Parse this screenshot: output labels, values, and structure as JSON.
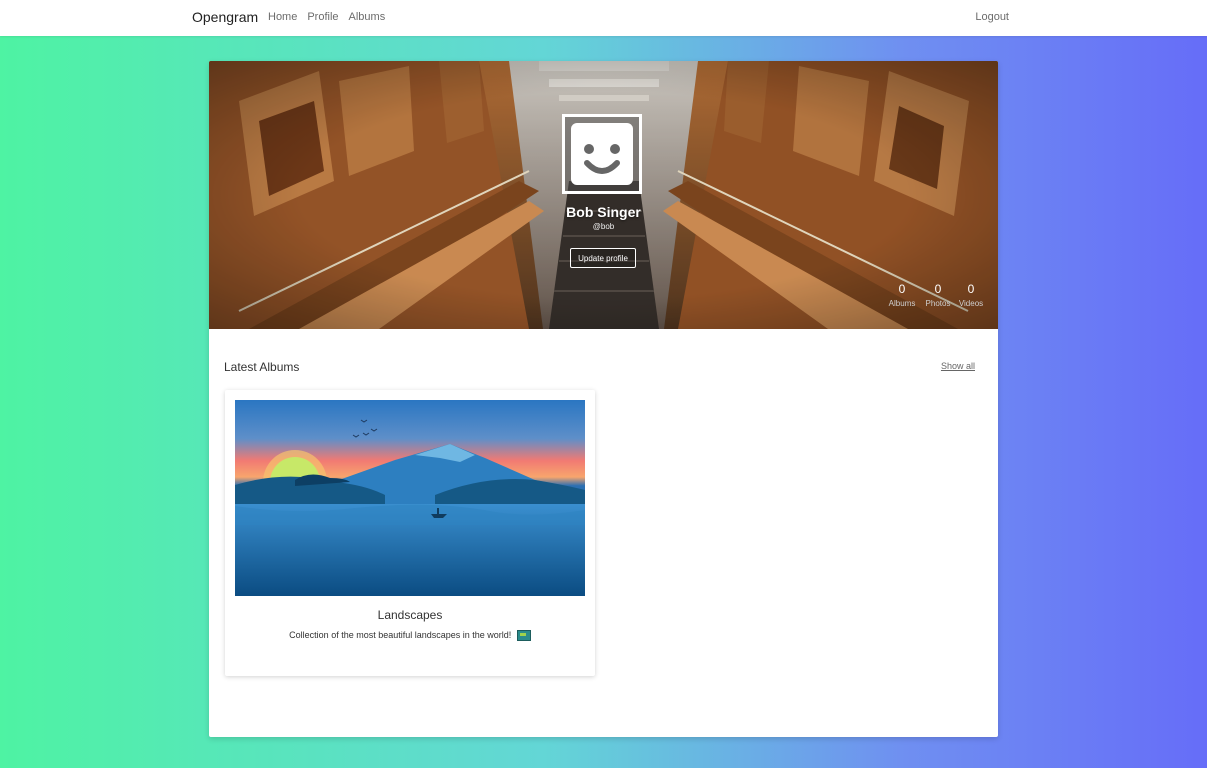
{
  "navbar": {
    "brand": "Opengram",
    "links": [
      "Home",
      "Profile",
      "Albums"
    ],
    "logout": "Logout"
  },
  "profile": {
    "name": "Bob Singer",
    "handle": "@bob",
    "update_button": "Update profile",
    "stats": [
      {
        "value": "0",
        "label": "Albums"
      },
      {
        "value": "0",
        "label": "Photos"
      },
      {
        "value": "0",
        "label": "Videos"
      }
    ],
    "avatar_icon": "smiley-face-icon"
  },
  "latest": {
    "title": "Latest Albums",
    "show_all": "Show all"
  },
  "albums": [
    {
      "title": "Landscapes",
      "description": "Collection of the most beautiful landscapes in the world!",
      "emoji_icon": "world-map-icon"
    }
  ],
  "colors": {
    "background_left": "#4ef3a3",
    "background_right": "#666df8"
  }
}
